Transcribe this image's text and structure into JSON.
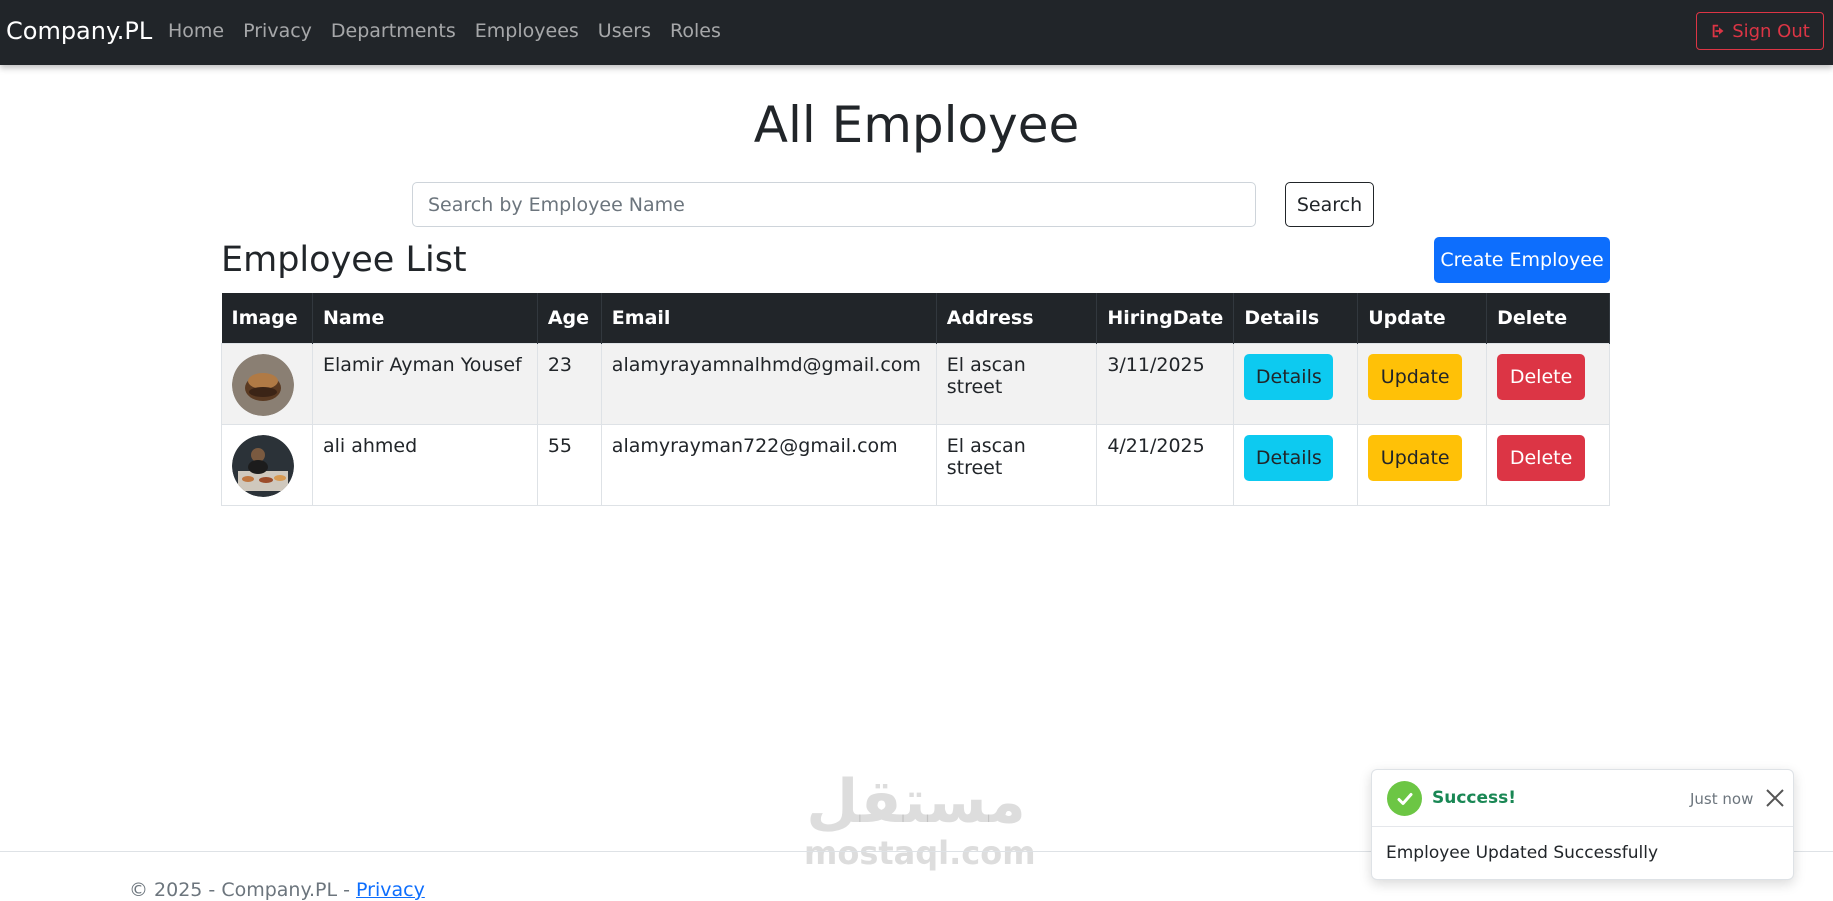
{
  "navbar": {
    "brand": "Company.PL",
    "links": [
      "Home",
      "Privacy",
      "Departments",
      "Employees",
      "Users",
      "Roles"
    ],
    "signout_label": "Sign Out"
  },
  "page": {
    "title": "All Employee",
    "search_placeholder": "Search by Employee Name",
    "search_label": "Search",
    "list_title": "Employee List",
    "create_label": "Create Employee"
  },
  "table": {
    "headers": [
      "Image",
      "Name",
      "Age",
      "Email",
      "Address",
      "HiringDate",
      "Details",
      "Update",
      "Delete"
    ],
    "rows": [
      {
        "name": "Elamir Ayman Yousef",
        "age": "23",
        "email": "alamyrayamnalhmd@gmail.com",
        "address": "El ascan street",
        "hiring_date": "3/11/2025",
        "details": "Details",
        "update": "Update",
        "delete": "Delete"
      },
      {
        "name": "ali ahmed",
        "age": "55",
        "email": "alamyrayman722@gmail.com",
        "address": "El ascan street",
        "hiring_date": "4/21/2025",
        "details": "Details",
        "update": "Update",
        "delete": "Delete"
      }
    ]
  },
  "toast": {
    "title": "Success!",
    "time": "Just now",
    "message": "Employee Updated Successfully"
  },
  "footer": {
    "text": "© 2025 - Company.PL - ",
    "link": "Privacy"
  },
  "watermark": {
    "arabic": "مستقل",
    "latin": "mostaql.com"
  },
  "colors": {
    "navbar": "#212529",
    "primary": "#0d6efd",
    "info": "#0dcaf0",
    "warning": "#ffc107",
    "danger": "#dc3545",
    "success": "#198754"
  }
}
